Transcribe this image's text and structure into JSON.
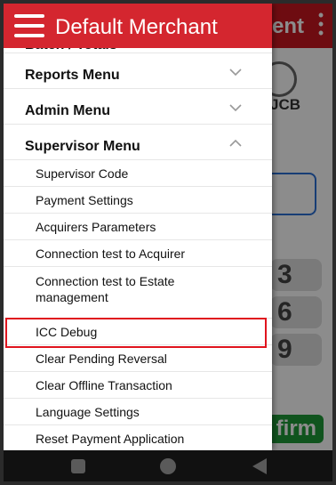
{
  "drawer": {
    "title": "Default Merchant",
    "partial_top_item": "Batch / Totals",
    "sections": [
      {
        "label": "Reports Menu",
        "expanded": false
      },
      {
        "label": "Admin Menu",
        "expanded": false
      },
      {
        "label": "Supervisor Menu",
        "expanded": true
      }
    ],
    "supervisor_items": [
      "Supervisor Code",
      "Payment Settings",
      "Acquirers Parameters",
      "Connection test to Acquirer",
      "Connection test to Estate management",
      "ICC Debug",
      "Clear Pending Reversal",
      "Clear Offline Transaction",
      "Language Settings",
      "Reset Payment Application"
    ],
    "highlighted_item": "ICC Debug"
  },
  "background": {
    "header_fragment": "ent",
    "card_label": "JCB",
    "keys": [
      "3",
      "6",
      "9"
    ],
    "confirm_fragment": "firm"
  },
  "colors": {
    "header": "#d4262f",
    "highlight": "#e0141e",
    "confirm": "#1e9a37"
  }
}
